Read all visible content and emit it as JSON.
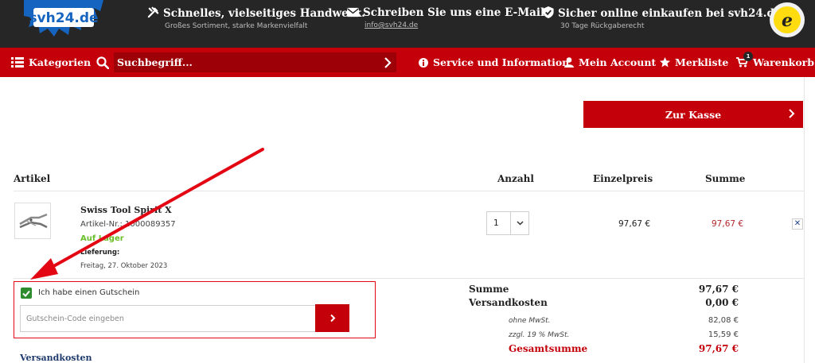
{
  "header": {
    "logo_text": "svh24.de",
    "usps": [
      {
        "title": "Schnelles, vielseitiges Handwerk.",
        "subtitle": "Großes Sortiment, starke Markenvielfalt",
        "icon": "tools-icon"
      },
      {
        "title": "Schreiben Sie uns eine E-Mail",
        "subtitle": "info@svh24.de",
        "icon": "mail-icon"
      },
      {
        "title": "Sicher online einkaufen bei svh24.de",
        "subtitle": "30 Tage Rückgaberecht",
        "icon": "shield-check-icon"
      }
    ],
    "trusted_badge": "TRUSTED SHOPS GUARANTEE"
  },
  "nav": {
    "categories": "Kategorien",
    "search_placeholder": "Suchbegriff...",
    "service": "Service und Information",
    "account": "Mein Account",
    "wishlist": "Merkliste",
    "cart": "Warenkorb",
    "cart_count": "1"
  },
  "checkout": {
    "button": "Zur Kasse"
  },
  "table": {
    "headers": {
      "article": "Artikel",
      "qty": "Anzahl",
      "unit_price": "Einzelpreis",
      "sum": "Summe"
    },
    "items": [
      {
        "name": "Swiss Tool Spirit X",
        "article_no": "Artikel-Nr.: 1000089357",
        "stock": "Auf Lager",
        "delivery_label": "Lieferung:",
        "delivery_date": "Freitag, 27. Oktober 2023",
        "qty": "1",
        "unit_price": "97,67 €",
        "sum": "97,67 €"
      }
    ]
  },
  "voucher": {
    "checkbox_label": "Ich habe einen Gutschein",
    "checked": true,
    "input_placeholder": "Gutschein-Code eingeben"
  },
  "shipping_link": "Versandkosten",
  "totals": {
    "sum_label": "Summe",
    "sum_value": "97,67 €",
    "shipping_label": "Versandkosten",
    "shipping_value": "0,00 €",
    "net_label": "ohne MwSt.",
    "net_value": "82,08 €",
    "vat_label": "zzgl. 19 % MwSt.",
    "vat_value": "15,59 €",
    "grand_label": "Gesamtsumme",
    "grand_value": "97,67 €"
  },
  "colors": {
    "brand_red": "#c4000b",
    "topbar": "#262626",
    "stock_green": "#6abf2a",
    "annotation_red": "#e30613"
  }
}
